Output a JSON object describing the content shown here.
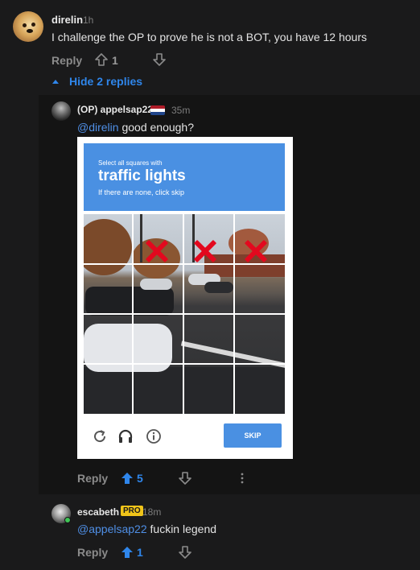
{
  "top_comment": {
    "username": "direlin",
    "time": "1h",
    "text": "I challenge the OP to prove he is not a BOT, you have 12 hours",
    "reply_label": "Reply",
    "score": "1",
    "hide_replies_label": "Hide 2 replies"
  },
  "replies": [
    {
      "username": "(OP) appelsap22",
      "time": "35m",
      "mention": "@direlin",
      "text": "good enough?",
      "reply_label": "Reply",
      "score": "5",
      "flag_colors": [
        "#ae1c28",
        "#ffffff",
        "#21468b"
      ]
    },
    {
      "username": "escabeth",
      "badge": "PRO",
      "time": "18m",
      "mention": "@appelsap22",
      "text": "fuckin legend",
      "reply_label": "Reply",
      "score": "1"
    }
  ],
  "captcha": {
    "line1": "Select all squares with",
    "line2": "traffic lights",
    "line3": "If there are none, click skip",
    "skip_label": "SKIP"
  },
  "colors": {
    "background": "#1a1a1b",
    "accent": "#2f86eb",
    "captcha_blue": "#4a90e2",
    "x_red": "#e3081e"
  }
}
